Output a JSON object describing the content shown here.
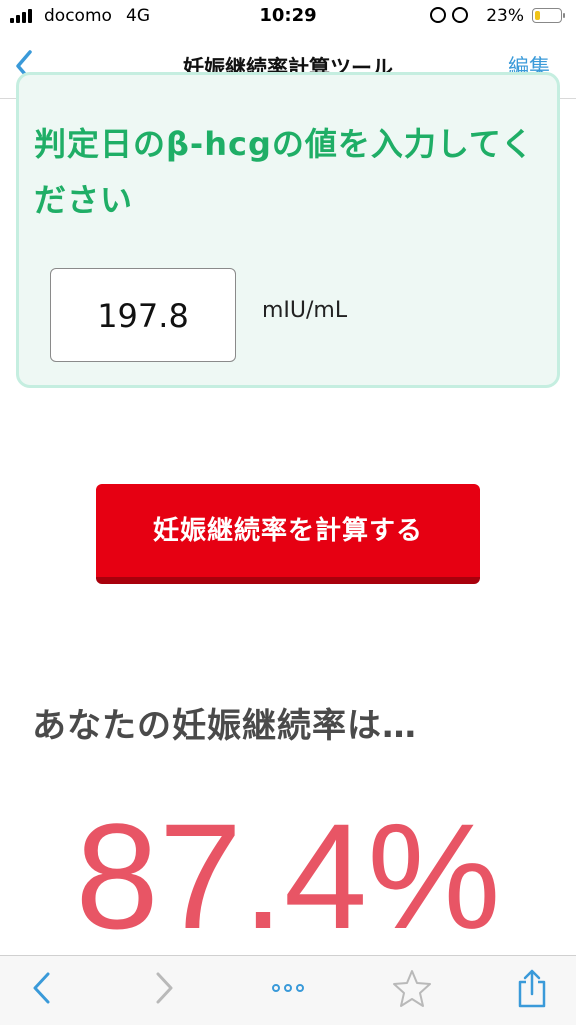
{
  "status_bar": {
    "carrier": "docomo",
    "network": "4G",
    "time": "10:29",
    "battery": "23%",
    "battery_level": 0.23
  },
  "nav": {
    "title": "妊娠継続率計算ツール",
    "edit": "編集"
  },
  "form": {
    "prompt": "判定日のβ-hcgの値を入力してください",
    "value": "197.8",
    "unit": "mIU/mL"
  },
  "button": {
    "label": "妊娠継続率を計算する"
  },
  "result": {
    "label": "あなたの妊娠継続率は…",
    "value": "87.4%"
  },
  "colors": {
    "accent_green": "#1fae66",
    "button_red": "#e60012",
    "result_red": "#e85565",
    "link_blue": "#3a9ad9"
  },
  "toolbar": {
    "icons": [
      "back-icon",
      "forward-icon",
      "more-icon",
      "bookmark-star-icon",
      "share-icon"
    ]
  }
}
